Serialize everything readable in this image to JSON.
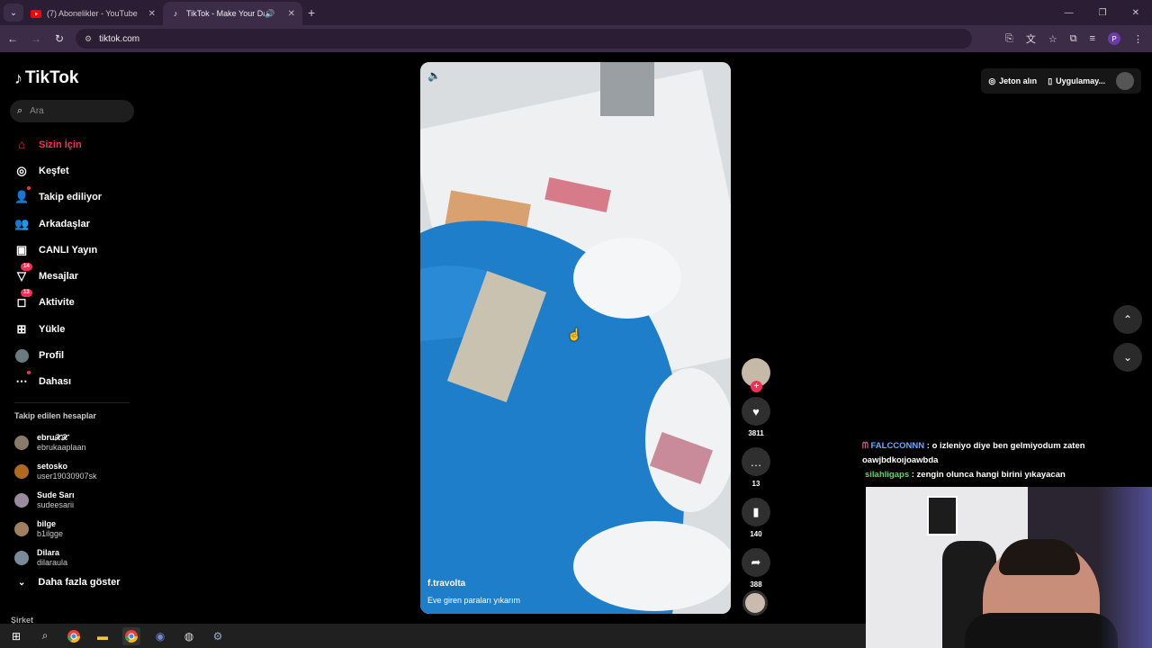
{
  "browser": {
    "tabs": [
      {
        "title": "(7) Abonelikler - YouTube",
        "active": false
      },
      {
        "title": "TikTok - Make Your Day",
        "active": true
      }
    ],
    "url": "tiktok.com",
    "profile_initial": "P"
  },
  "tiktok": {
    "logo": "TikTok",
    "search_placeholder": "Ara",
    "menu": [
      {
        "label": "Sizin İçin",
        "icon": "home-icon"
      },
      {
        "label": "Keşfet",
        "icon": "compass-icon"
      },
      {
        "label": "Takip ediliyor",
        "icon": "following-icon"
      },
      {
        "label": "Arkadaşlar",
        "icon": "friends-icon"
      },
      {
        "label": "CANLI Yayın",
        "icon": "live-icon"
      },
      {
        "label": "Mesajlar",
        "icon": "messages-icon",
        "badge": "14"
      },
      {
        "label": "Aktivite",
        "icon": "activity-icon",
        "badge": "13"
      },
      {
        "label": "Yükle",
        "icon": "upload-icon"
      },
      {
        "label": "Profil",
        "icon": "profile-icon"
      },
      {
        "label": "Dahası",
        "icon": "more-icon"
      }
    ],
    "following_header": "Takip edilen hesaplar",
    "following": [
      {
        "name": "ebru𝒳𝒳",
        "username": "ebrukaaplaan"
      },
      {
        "name": "setosko",
        "username": "user19030907sk"
      },
      {
        "name": "Sude Sarı",
        "username": "sudeesarii"
      },
      {
        "name": "bilge",
        "username": "b1ilgge"
      },
      {
        "name": "Dilara",
        "username": "dilaraula"
      }
    ],
    "show_more": "Daha fazla göster",
    "company": "Şirket",
    "top_right": {
      "coins": "Jeton alın",
      "app": "Uygulamay..."
    },
    "video": {
      "author": "f.travolta",
      "caption": "Eve giren paraları yıkarım",
      "likes": "3811",
      "comments": "13",
      "saves": "140",
      "shares": "388"
    }
  },
  "chat": [
    {
      "user": "FALCCONNN",
      "message": ": o izleniyo diye ben gelmiyodum zaten oawjbdkoıjoawbda"
    },
    {
      "user": "silahligaps",
      "message": ": zengin olunca hangi birini yıkayacan"
    }
  ],
  "colors": {
    "accent": "#fe2c55",
    "chat_user1": "#6aa9ff",
    "chat_user2": "#45e06a"
  }
}
